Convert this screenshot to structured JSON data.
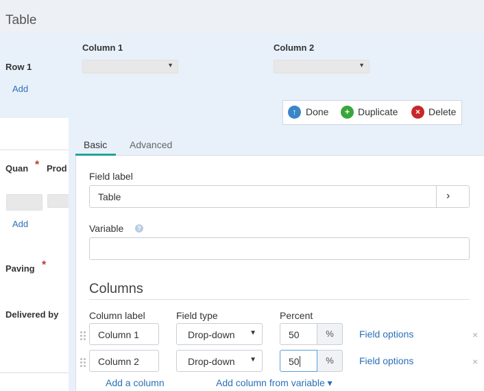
{
  "page": {
    "title": "Table"
  },
  "table": {
    "row_label": "Row 1",
    "add_row_label": "Add",
    "columns": [
      "Column 1",
      "Column 2"
    ],
    "caret": "▼"
  },
  "left_form": {
    "field1_label": "Quan",
    "field2_label": "Prod",
    "add_label": "Add",
    "paving_label": "Paving",
    "delivered_label": "Delivered by",
    "required_mark": "*"
  },
  "actions": {
    "done": "Done",
    "duplicate": "Duplicate",
    "delete": "Delete",
    "done_icon_glyph": "↑",
    "duplicate_icon_glyph": "+",
    "delete_icon_glyph": "×"
  },
  "tabs": [
    {
      "label": "Basic",
      "active": true
    },
    {
      "label": "Advanced",
      "active": false
    }
  ],
  "basic": {
    "field_label_title": "Field label",
    "field_label_value": "Table",
    "expand_glyph": "›",
    "variable_title": "Variable",
    "variable_value": "",
    "help_glyph": "?",
    "columns_section": "Columns",
    "column_headers": {
      "label": "Column label",
      "type": "Field type",
      "percent": "Percent"
    },
    "column_rows": [
      {
        "label": "Column 1",
        "type": "Drop-down",
        "percent": "50",
        "unit": "%",
        "options_link": "Field options"
      },
      {
        "label": "Column 2",
        "type": "Drop-down",
        "percent": "50",
        "unit": "%",
        "options_link": "Field options"
      }
    ],
    "remove_glyph": "×",
    "add_column": "Add a column",
    "add_from_variable": "Add column from variable",
    "add_from_variable_caret": "▾"
  },
  "colors": {
    "accent": "#1fa39a",
    "link": "#2a6fb8",
    "done_icon": "#3b86c9",
    "duplicate_icon": "#3aa63a",
    "delete_icon": "#c62828",
    "required": "#c0392b"
  }
}
